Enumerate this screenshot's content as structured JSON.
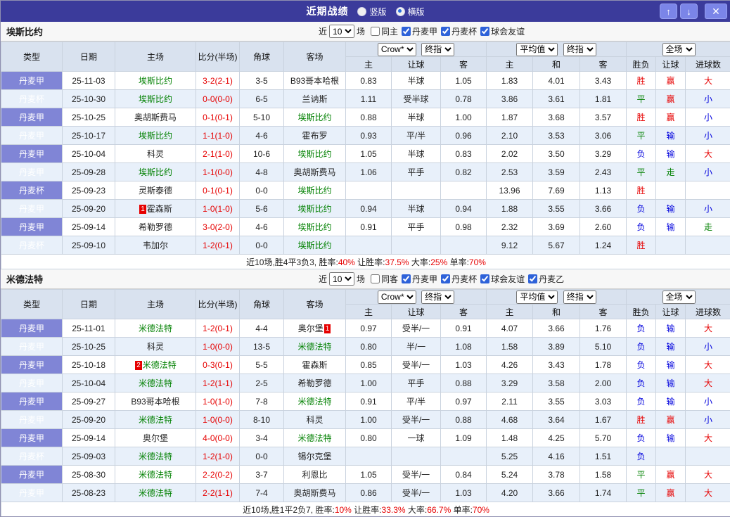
{
  "titlebar": {
    "title": "近期战绩",
    "options": [
      {
        "label": "竖版",
        "selected": false
      },
      {
        "label": "横版",
        "selected": true
      }
    ],
    "buttons": {
      "up": "↑",
      "down": "↓",
      "close": "✕"
    }
  },
  "colors": {
    "titlebar_bg": "#3B3B9B",
    "button_bg": "#7B85E8",
    "type_cell_bg": "#8085D6",
    "header_bg": "#D9E2EF",
    "stripe_bg": "#E8F0FA",
    "win_red": "#E60000",
    "draw_green": "#008000",
    "loss_blue": "#0000DD",
    "team_highlight": "#008000"
  },
  "sections": [
    {
      "team": "埃斯比约",
      "filters": {
        "near": "近",
        "count": "10",
        "unit": "场",
        "options": [
          {
            "label": "同主",
            "checked": false
          },
          {
            "label": "丹麦甲",
            "checked": true
          },
          {
            "label": "丹麦杯",
            "checked": true
          },
          {
            "label": "球会友谊",
            "checked": true
          }
        ]
      },
      "columns": {
        "type": "类型",
        "date": "日期",
        "home": "主场",
        "score": "比分(半场)",
        "corner": "角球",
        "away": "客场",
        "g1_selects": [
          "Crow*",
          "终指"
        ],
        "g1_cols": [
          "主",
          "让球",
          "客"
        ],
        "g2_selects": [
          "平均值",
          "终指"
        ],
        "g2_cols": [
          "主",
          "和",
          "客"
        ],
        "g3_selects": [
          "全场"
        ],
        "g3_cols": [
          "胜负",
          "让球",
          "进球数"
        ]
      },
      "rows": [
        {
          "type": "丹麦甲",
          "date": "25-11-03",
          "home": {
            "n": "埃斯比约",
            "hl": true
          },
          "score": "3-2(2-1)",
          "corner": "3-5",
          "away": {
            "n": "B93哥本哈根",
            "hl": false
          },
          "o1": [
            "0.83",
            "半球",
            "1.05"
          ],
          "o2": [
            "1.83",
            "4.01",
            "3.43"
          ],
          "res": [
            {
              "t": "胜",
              "c": "red"
            },
            {
              "t": "赢",
              "c": "red"
            },
            {
              "t": "大",
              "c": "red"
            }
          ]
        },
        {
          "type": "丹麦杯",
          "date": "25-10-30",
          "home": {
            "n": "埃斯比约",
            "hl": true
          },
          "score": "0-0(0-0)",
          "corner": "6-5",
          "away": {
            "n": "兰讷斯",
            "hl": false
          },
          "o1": [
            "1.11",
            "受半球",
            "0.78"
          ],
          "o2": [
            "3.86",
            "3.61",
            "1.81"
          ],
          "res": [
            {
              "t": "平",
              "c": "green"
            },
            {
              "t": "赢",
              "c": "red"
            },
            {
              "t": "小",
              "c": "blue"
            }
          ]
        },
        {
          "type": "丹麦甲",
          "date": "25-10-25",
          "home": {
            "n": "奥胡斯费马",
            "hl": false
          },
          "score": "0-1(0-1)",
          "corner": "5-10",
          "away": {
            "n": "埃斯比约",
            "hl": true
          },
          "o1": [
            "0.88",
            "半球",
            "1.00"
          ],
          "o2": [
            "1.87",
            "3.68",
            "3.57"
          ],
          "res": [
            {
              "t": "胜",
              "c": "red"
            },
            {
              "t": "赢",
              "c": "red"
            },
            {
              "t": "小",
              "c": "blue"
            }
          ]
        },
        {
          "type": "丹麦甲",
          "date": "25-10-17",
          "home": {
            "n": "埃斯比约",
            "hl": true
          },
          "score": "1-1(1-0)",
          "corner": "4-6",
          "away": {
            "n": "霍布罗",
            "hl": false
          },
          "o1": [
            "0.93",
            "平/半",
            "0.96"
          ],
          "o2": [
            "2.10",
            "3.53",
            "3.06"
          ],
          "res": [
            {
              "t": "平",
              "c": "green"
            },
            {
              "t": "输",
              "c": "blue"
            },
            {
              "t": "小",
              "c": "blue"
            }
          ]
        },
        {
          "type": "丹麦甲",
          "date": "25-10-04",
          "home": {
            "n": "科灵",
            "hl": false
          },
          "score": "2-1(1-0)",
          "corner": "10-6",
          "away": {
            "n": "埃斯比约",
            "hl": true
          },
          "o1": [
            "1.05",
            "半球",
            "0.83"
          ],
          "o2": [
            "2.02",
            "3.50",
            "3.29"
          ],
          "res": [
            {
              "t": "负",
              "c": "blue"
            },
            {
              "t": "输",
              "c": "blue"
            },
            {
              "t": "大",
              "c": "red"
            }
          ]
        },
        {
          "type": "丹麦甲",
          "date": "25-09-28",
          "home": {
            "n": "埃斯比约",
            "hl": true
          },
          "score": "1-1(0-0)",
          "corner": "4-8",
          "away": {
            "n": "奥胡斯费马",
            "hl": false
          },
          "o1": [
            "1.06",
            "平手",
            "0.82"
          ],
          "o2": [
            "2.53",
            "3.59",
            "2.43"
          ],
          "res": [
            {
              "t": "平",
              "c": "green"
            },
            {
              "t": "走",
              "c": "green"
            },
            {
              "t": "小",
              "c": "blue"
            }
          ]
        },
        {
          "type": "丹麦杯",
          "date": "25-09-23",
          "home": {
            "n": "灵斯泰德",
            "hl": false
          },
          "score": "0-1(0-1)",
          "corner": "0-0",
          "away": {
            "n": "埃斯比约",
            "hl": true
          },
          "o1": [
            "",
            "",
            ""
          ],
          "o2": [
            "13.96",
            "7.69",
            "1.13"
          ],
          "res": [
            {
              "t": "胜",
              "c": "red"
            },
            {
              "t": "",
              "c": ""
            },
            {
              "t": "",
              "c": ""
            }
          ]
        },
        {
          "type": "丹麦甲",
          "date": "25-09-20",
          "home": {
            "n": "霍森斯",
            "hl": false,
            "b": "1"
          },
          "score": "1-0(1-0)",
          "corner": "5-6",
          "away": {
            "n": "埃斯比约",
            "hl": true
          },
          "o1": [
            "0.94",
            "半球",
            "0.94"
          ],
          "o2": [
            "1.88",
            "3.55",
            "3.66"
          ],
          "res": [
            {
              "t": "负",
              "c": "blue"
            },
            {
              "t": "输",
              "c": "blue"
            },
            {
              "t": "小",
              "c": "blue"
            }
          ]
        },
        {
          "type": "丹麦甲",
          "date": "25-09-14",
          "home": {
            "n": "希勒罗德",
            "hl": false
          },
          "score": "3-0(2-0)",
          "corner": "4-6",
          "away": {
            "n": "埃斯比约",
            "hl": true
          },
          "o1": [
            "0.91",
            "平手",
            "0.98"
          ],
          "o2": [
            "2.32",
            "3.69",
            "2.60"
          ],
          "res": [
            {
              "t": "负",
              "c": "blue"
            },
            {
              "t": "输",
              "c": "blue"
            },
            {
              "t": "走",
              "c": "green"
            }
          ]
        },
        {
          "type": "丹麦杯",
          "date": "25-09-10",
          "home": {
            "n": "韦加尔",
            "hl": false
          },
          "score": "1-2(0-1)",
          "corner": "0-0",
          "away": {
            "n": "埃斯比约",
            "hl": true
          },
          "o1": [
            "",
            "",
            ""
          ],
          "o2": [
            "9.12",
            "5.67",
            "1.24"
          ],
          "res": [
            {
              "t": "胜",
              "c": "red"
            },
            {
              "t": "",
              "c": ""
            },
            {
              "t": "",
              "c": ""
            }
          ]
        }
      ],
      "summary": [
        {
          "t": "近10场,胜4平3负3, 胜率:",
          "c": ""
        },
        {
          "t": "40%",
          "c": "red"
        },
        {
          "t": " 让胜率:",
          "c": ""
        },
        {
          "t": "37.5%",
          "c": "red"
        },
        {
          "t": " 大率:",
          "c": ""
        },
        {
          "t": "25%",
          "c": "red"
        },
        {
          "t": " 单率:",
          "c": ""
        },
        {
          "t": "70%",
          "c": "red"
        }
      ]
    },
    {
      "team": "米德法特",
      "filters": {
        "near": "近",
        "count": "10",
        "unit": "场",
        "options": [
          {
            "label": "同客",
            "checked": false
          },
          {
            "label": "丹麦甲",
            "checked": true
          },
          {
            "label": "丹麦杯",
            "checked": true
          },
          {
            "label": "球会友谊",
            "checked": true
          },
          {
            "label": "丹麦乙",
            "checked": true
          }
        ]
      },
      "columns": {
        "type": "类型",
        "date": "日期",
        "home": "主场",
        "score": "比分(半场)",
        "corner": "角球",
        "away": "客场",
        "g1_selects": [
          "Crow*",
          "终指"
        ],
        "g1_cols": [
          "主",
          "让球",
          "客"
        ],
        "g2_selects": [
          "平均值",
          "终指"
        ],
        "g2_cols": [
          "主",
          "和",
          "客"
        ],
        "g3_selects": [
          "全场"
        ],
        "g3_cols": [
          "胜负",
          "让球",
          "进球数"
        ]
      },
      "rows": [
        {
          "type": "丹麦甲",
          "date": "25-11-01",
          "home": {
            "n": "米德法特",
            "hl": true
          },
          "score": "1-2(0-1)",
          "corner": "4-4",
          "away": {
            "n": "奥尔堡",
            "hl": false,
            "ba": "1"
          },
          "o1": [
            "0.97",
            "受半/一",
            "0.91"
          ],
          "o2": [
            "4.07",
            "3.66",
            "1.76"
          ],
          "res": [
            {
              "t": "负",
              "c": "blue"
            },
            {
              "t": "输",
              "c": "blue"
            },
            {
              "t": "大",
              "c": "red"
            }
          ]
        },
        {
          "type": "丹麦甲",
          "date": "25-10-25",
          "home": {
            "n": "科灵",
            "hl": false
          },
          "score": "1-0(0-0)",
          "corner": "13-5",
          "away": {
            "n": "米德法特",
            "hl": true
          },
          "o1": [
            "0.80",
            "半/一",
            "1.08"
          ],
          "o2": [
            "1.58",
            "3.89",
            "5.10"
          ],
          "res": [
            {
              "t": "负",
              "c": "blue"
            },
            {
              "t": "输",
              "c": "blue"
            },
            {
              "t": "小",
              "c": "blue"
            }
          ]
        },
        {
          "type": "丹麦甲",
          "date": "25-10-18",
          "home": {
            "n": "米德法特",
            "hl": true,
            "b": "2"
          },
          "score": "0-3(0-1)",
          "corner": "5-5",
          "away": {
            "n": "霍森斯",
            "hl": false
          },
          "o1": [
            "0.85",
            "受半/一",
            "1.03"
          ],
          "o2": [
            "4.26",
            "3.43",
            "1.78"
          ],
          "res": [
            {
              "t": "负",
              "c": "blue"
            },
            {
              "t": "输",
              "c": "blue"
            },
            {
              "t": "大",
              "c": "red"
            }
          ]
        },
        {
          "type": "丹麦甲",
          "date": "25-10-04",
          "home": {
            "n": "米德法特",
            "hl": true
          },
          "score": "1-2(1-1)",
          "corner": "2-5",
          "away": {
            "n": "希勒罗德",
            "hl": false
          },
          "o1": [
            "1.00",
            "平手",
            "0.88"
          ],
          "o2": [
            "3.29",
            "3.58",
            "2.00"
          ],
          "res": [
            {
              "t": "负",
              "c": "blue"
            },
            {
              "t": "输",
              "c": "blue"
            },
            {
              "t": "大",
              "c": "red"
            }
          ]
        },
        {
          "type": "丹麦甲",
          "date": "25-09-27",
          "home": {
            "n": "B93哥本哈根",
            "hl": false
          },
          "score": "1-0(1-0)",
          "corner": "7-8",
          "away": {
            "n": "米德法特",
            "hl": true
          },
          "o1": [
            "0.91",
            "平/半",
            "0.97"
          ],
          "o2": [
            "2.11",
            "3.55",
            "3.03"
          ],
          "res": [
            {
              "t": "负",
              "c": "blue"
            },
            {
              "t": "输",
              "c": "blue"
            },
            {
              "t": "小",
              "c": "blue"
            }
          ]
        },
        {
          "type": "丹麦甲",
          "date": "25-09-20",
          "home": {
            "n": "米德法特",
            "hl": true
          },
          "score": "1-0(0-0)",
          "corner": "8-10",
          "away": {
            "n": "科灵",
            "hl": false
          },
          "o1": [
            "1.00",
            "受半/一",
            "0.88"
          ],
          "o2": [
            "4.68",
            "3.64",
            "1.67"
          ],
          "res": [
            {
              "t": "胜",
              "c": "red"
            },
            {
              "t": "赢",
              "c": "red"
            },
            {
              "t": "小",
              "c": "blue"
            }
          ]
        },
        {
          "type": "丹麦甲",
          "date": "25-09-14",
          "home": {
            "n": "奥尔堡",
            "hl": false
          },
          "score": "4-0(0-0)",
          "corner": "3-4",
          "away": {
            "n": "米德法特",
            "hl": true
          },
          "o1": [
            "0.80",
            "一球",
            "1.09"
          ],
          "o2": [
            "1.48",
            "4.25",
            "5.70"
          ],
          "res": [
            {
              "t": "负",
              "c": "blue"
            },
            {
              "t": "输",
              "c": "blue"
            },
            {
              "t": "大",
              "c": "red"
            }
          ]
        },
        {
          "type": "丹麦杯",
          "date": "25-09-03",
          "home": {
            "n": "米德法特",
            "hl": true
          },
          "score": "1-2(1-0)",
          "corner": "0-0",
          "away": {
            "n": "锡尔克堡",
            "hl": false
          },
          "o1": [
            "",
            "",
            ""
          ],
          "o2": [
            "5.25",
            "4.16",
            "1.51"
          ],
          "res": [
            {
              "t": "负",
              "c": "blue"
            },
            {
              "t": "",
              "c": ""
            },
            {
              "t": "",
              "c": ""
            }
          ]
        },
        {
          "type": "丹麦甲",
          "date": "25-08-30",
          "home": {
            "n": "米德法特",
            "hl": true
          },
          "score": "2-2(0-2)",
          "corner": "3-7",
          "away": {
            "n": "利恩比",
            "hl": false
          },
          "o1": [
            "1.05",
            "受半/一",
            "0.84"
          ],
          "o2": [
            "5.24",
            "3.78",
            "1.58"
          ],
          "res": [
            {
              "t": "平",
              "c": "green"
            },
            {
              "t": "赢",
              "c": "red"
            },
            {
              "t": "大",
              "c": "red"
            }
          ]
        },
        {
          "type": "丹麦甲",
          "date": "25-08-23",
          "home": {
            "n": "米德法特",
            "hl": true
          },
          "score": "2-2(1-1)",
          "corner": "7-4",
          "away": {
            "n": "奥胡斯费马",
            "hl": false
          },
          "o1": [
            "0.86",
            "受半/一",
            "1.03"
          ],
          "o2": [
            "4.20",
            "3.66",
            "1.74"
          ],
          "res": [
            {
              "t": "平",
              "c": "green"
            },
            {
              "t": "赢",
              "c": "red"
            },
            {
              "t": "大",
              "c": "red"
            }
          ]
        }
      ],
      "summary": [
        {
          "t": "近10场,胜1平2负7, 胜率:",
          "c": ""
        },
        {
          "t": "10%",
          "c": "red"
        },
        {
          "t": " 让胜率:",
          "c": ""
        },
        {
          "t": "33.3%",
          "c": "red"
        },
        {
          "t": " 大率:",
          "c": ""
        },
        {
          "t": "66.7%",
          "c": "red"
        },
        {
          "t": " 单率:",
          "c": ""
        },
        {
          "t": "70%",
          "c": "red"
        }
      ]
    }
  ]
}
